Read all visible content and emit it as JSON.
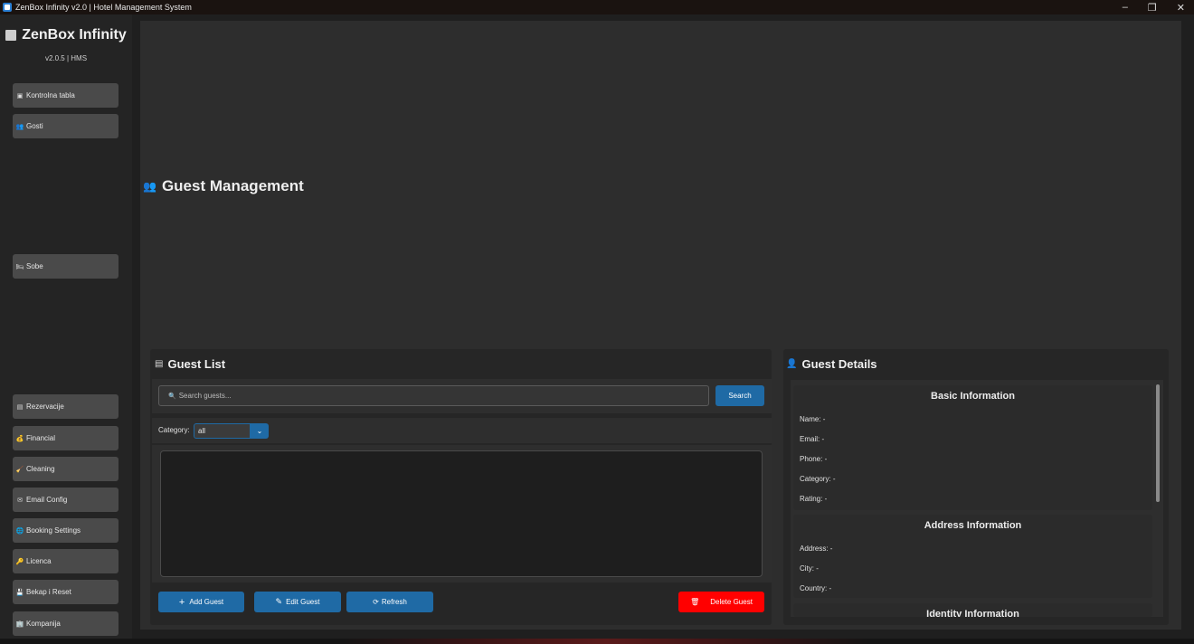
{
  "window": {
    "title": "ZenBox Infinity v2.0 | Hotel Management System",
    "controls": {
      "minimize": "–",
      "restore": "❐",
      "close": "✕"
    }
  },
  "sidebar": {
    "brand": "ZenBox Infinity",
    "version": "v2.0.5 | HMS",
    "items": [
      {
        "label": "Kontrolna tabla",
        "icon": "dashboard-icon",
        "glyph": "▣"
      },
      {
        "label": "Gosti",
        "icon": "guests-icon",
        "glyph": "👥"
      },
      {
        "label": "Sobe",
        "icon": "rooms-icon",
        "glyph": "🛏"
      },
      {
        "label": "Rezervacije",
        "icon": "calendar-icon",
        "glyph": "▤"
      },
      {
        "label": "Financial",
        "icon": "money-icon",
        "glyph": "💰"
      },
      {
        "label": "Cleaning",
        "icon": "broom-icon",
        "glyph": "🧹"
      },
      {
        "label": "Email Config",
        "icon": "mail-icon",
        "glyph": "✉"
      },
      {
        "label": "Booking Settings",
        "icon": "globe-icon",
        "glyph": "🌐"
      },
      {
        "label": "Licenca",
        "icon": "key-icon",
        "glyph": "🔑"
      },
      {
        "label": "Bekap i Reset",
        "icon": "save-icon",
        "glyph": "💾"
      },
      {
        "label": "Kompanija",
        "icon": "building-icon",
        "glyph": "🏢"
      }
    ]
  },
  "page": {
    "title": "Guest Management"
  },
  "guest_list": {
    "title": "Guest List",
    "search_placeholder": "Search guests...",
    "search_button": "Search",
    "category_label": "Category:",
    "category_value": "all",
    "add_button": "Add Guest",
    "edit_button": "Edit Guest",
    "refresh_button": "Refresh",
    "delete_button": "Delete Guest"
  },
  "guest_details": {
    "title": "Guest Details",
    "basic": {
      "title": "Basic Information",
      "name": "Name: -",
      "email": "Email: -",
      "phone": "Phone: -",
      "category": "Category: -",
      "rating": "Rating: -"
    },
    "address": {
      "title": "Address Information",
      "address": "Address: -",
      "city": "City: -",
      "country": "Country: -"
    },
    "identity": {
      "title": "Identity Information"
    }
  },
  "colors": {
    "accent": "#1f6aa5",
    "danger": "#ff0000",
    "background": "#2d2d2d"
  }
}
